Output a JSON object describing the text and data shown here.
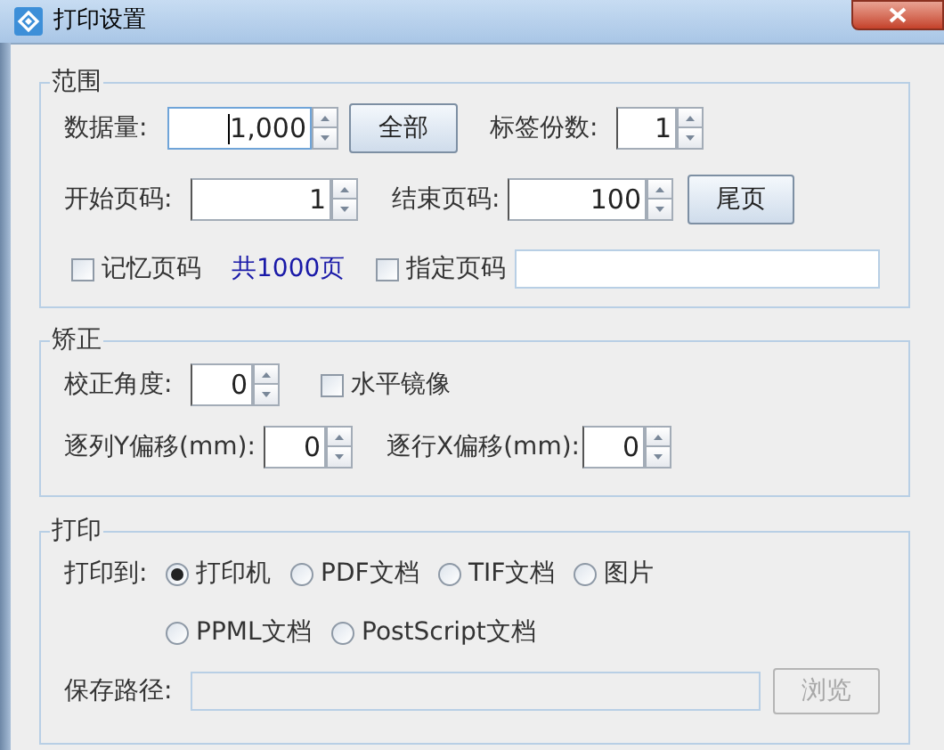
{
  "window": {
    "title": "打印设置"
  },
  "groups": [
    {
      "title": "范围",
      "items": [
        {
          "kind": "label",
          "text": "数据量:"
        },
        {
          "kind": "spinner",
          "value": "1,000",
          "focused": true
        },
        {
          "kind": "button",
          "label": "全部",
          "disabled": false
        },
        {
          "kind": "label",
          "text": "标签份数:"
        },
        {
          "kind": "spinner",
          "value": "1",
          "focused": false
        },
        {
          "kind": "label",
          "text": "开始页码:"
        },
        {
          "kind": "spinner",
          "value": "1",
          "focused": false
        },
        {
          "kind": "label",
          "text": "结束页码:"
        },
        {
          "kind": "spinner",
          "value": "100",
          "focused": false
        },
        {
          "kind": "button",
          "label": "尾页",
          "disabled": false
        },
        {
          "kind": "checkbox",
          "label": "记忆页码",
          "checked": false
        },
        {
          "kind": "note",
          "text": "共1000页"
        },
        {
          "kind": "checkbox",
          "label": "指定页码",
          "checked": false
        },
        {
          "kind": "field",
          "disabled": false
        }
      ]
    },
    {
      "title": "矫正",
      "items": [
        {
          "kind": "label",
          "text": "校正角度:"
        },
        {
          "kind": "spinner",
          "value": "0",
          "focused": false
        },
        {
          "kind": "checkbox",
          "label": "水平镜像",
          "checked": false
        },
        {
          "kind": "label",
          "text": "逐列Y偏移(mm):"
        },
        {
          "kind": "spinner",
          "value": "0",
          "focused": false
        },
        {
          "kind": "label",
          "text": "逐行X偏移(mm):"
        },
        {
          "kind": "spinner",
          "value": "0",
          "focused": false
        }
      ]
    },
    {
      "title": "打印",
      "items": [
        {
          "kind": "radio_group",
          "label": "打印到:",
          "options": [
            {
              "label": "打印机",
              "selected": true
            },
            {
              "label": "PDF文档",
              "selected": false
            },
            {
              "label": "TIF文档",
              "selected": false
            },
            {
              "label": "图片",
              "selected": false
            },
            {
              "label": "PPML文档",
              "selected": false
            },
            {
              "label": "PostScript文档",
              "selected": false
            }
          ]
        },
        {
          "kind": "label",
          "text": "保存路径:"
        },
        {
          "kind": "field",
          "disabled": true
        },
        {
          "kind": "button",
          "label": "浏览",
          "disabled": true
        }
      ]
    }
  ]
}
